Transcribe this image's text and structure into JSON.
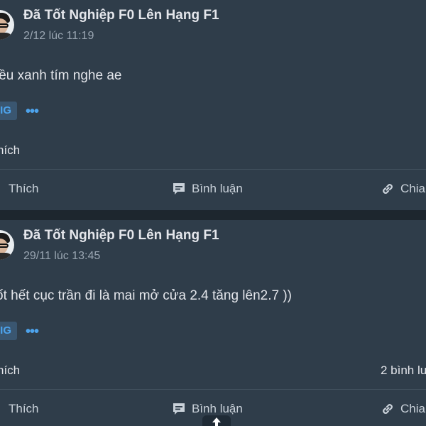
{
  "posts": [
    {
      "author": "Đã Tốt Nghiệp F0 Lên Hạng F1",
      "time": "2/12 lúc 11:19",
      "content": "iều xanh tím nghe ae",
      "tag": "IG",
      "more": "•••",
      "likes": "hích",
      "comments_count": "",
      "actions": {
        "like": "Thích",
        "comment": "Bình luận",
        "share": "Chia"
      }
    },
    {
      "author": "Đã Tốt Nghiệp F0 Lên Hạng F1",
      "time": "29/11 lúc 13:45",
      "content": "ốt hết cục trần đi là mai mở cửa 2.4 tăng lên2.7 ))",
      "tag": "IG",
      "more": "•••",
      "likes": "hích",
      "comments_count": "2 bình lu",
      "actions": {
        "like": "Thích",
        "comment": "Bình luận",
        "share": "Chia"
      }
    }
  ],
  "colors": {
    "background": "#2f3d4a",
    "text": "#e4e6eb",
    "secondary_text": "#9aa6b2",
    "accent": "#4da3ec"
  },
  "icons": {
    "like": "thumbs-up-icon",
    "comment": "comment-icon",
    "share": "link-icon",
    "scroll_top": "arrow-up-icon"
  }
}
